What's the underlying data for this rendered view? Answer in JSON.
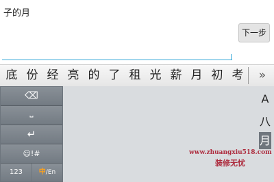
{
  "input": {
    "typed_text": "子的月",
    "next_button": "下一步"
  },
  "candidates": [
    "底",
    "份",
    "经",
    "亮",
    "的",
    "了",
    "租",
    "光",
    "薪",
    "月",
    "初",
    "考"
  ],
  "expand_icon": "»",
  "keyboard": {
    "delete_icon": "⌫",
    "space_icon": "⎵",
    "enter_icon": "↵",
    "symbol_label": "☺!#",
    "number_label": "123",
    "lang_zh": "中",
    "lang_en": "/En",
    "index_letters": [
      "A",
      "八",
      "月"
    ]
  },
  "watermark": {
    "url": "www.zhuangxiu518.com",
    "text": "装修无忧"
  },
  "colors": {
    "accent_line": "#33a7d8",
    "key_bg": "#7d858c",
    "lang_zh": "#ffa21a",
    "watermark": "#ad2b3d"
  }
}
